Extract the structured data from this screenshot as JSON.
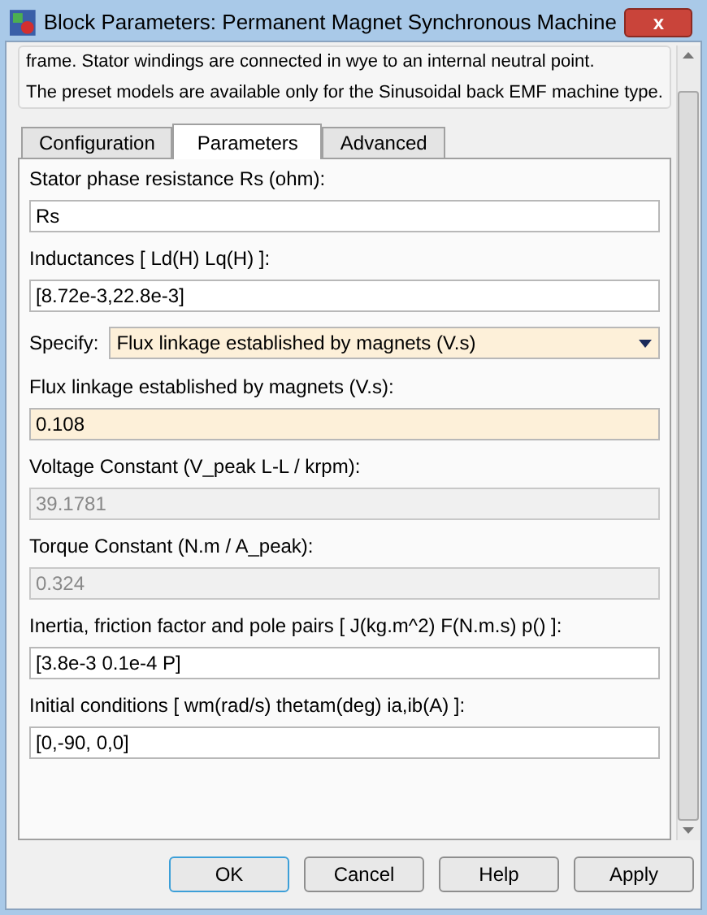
{
  "window": {
    "title": "Block Parameters: Permanent Magnet Synchronous Machine",
    "close": "x"
  },
  "description": [
    "frame. Stator windings are connected in wye to an internal neutral point.",
    "The preset models are available only for the Sinusoidal back EMF machine type."
  ],
  "tabs": [
    {
      "label": "Configuration",
      "selected": false
    },
    {
      "label": "Parameters",
      "selected": true
    },
    {
      "label": "Advanced",
      "selected": false
    }
  ],
  "parameters": [
    {
      "kind": "field",
      "label": "Stator phase resistance Rs (ohm):",
      "value": "Rs",
      "disabled": false,
      "modified": false
    },
    {
      "kind": "field",
      "label": "Inductances [ Ld(H) Lq(H) ]:",
      "value": "[8.72e-3,22.8e-3]",
      "disabled": false,
      "modified": false
    },
    {
      "kind": "dropdown",
      "label": "Specify:",
      "value": "Flux linkage established by magnets (V.s)",
      "disabled": false,
      "modified": true
    },
    {
      "kind": "field",
      "label": "Flux linkage established by magnets (V.s):",
      "value": "0.108",
      "disabled": false,
      "modified": true
    },
    {
      "kind": "field",
      "label": "Voltage Constant (V_peak L-L / krpm):",
      "value": "39.1781",
      "disabled": true
    },
    {
      "kind": "field",
      "label": "Torque Constant (N.m / A_peak):",
      "value": "0.324",
      "disabled": true
    },
    {
      "kind": "field",
      "label": "Inertia, friction factor and pole pairs [ J(kg.m^2)  F(N.m.s)  p() ]:",
      "value": "[3.8e-3 0.1e-4 P]",
      "disabled": false,
      "modified": false
    },
    {
      "kind": "field",
      "label": "Initial conditions  [ wm(rad/s)  thetam(deg)  ia,ib(A) ]:",
      "value": "[0,-90, 0,0]",
      "disabled": false,
      "modified": false
    }
  ],
  "buttons": [
    {
      "label": "OK",
      "selected": true
    },
    {
      "label": "Cancel",
      "selected": false
    },
    {
      "label": "Help",
      "selected": false
    },
    {
      "label": "Apply",
      "selected": false
    }
  ]
}
